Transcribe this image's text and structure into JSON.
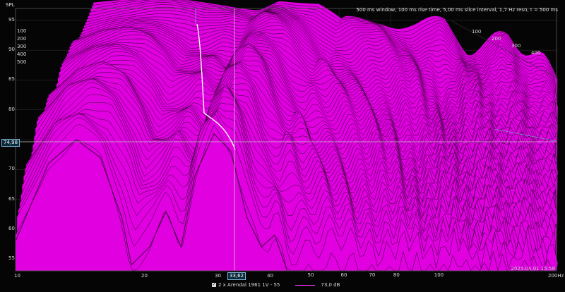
{
  "header": {
    "spl_label": "SPL",
    "info": "500 ms window, 100 ms rise time, 5,00 ms slice interval, 1,7 Hz resn, t = 500 ms"
  },
  "y_axis": {
    "ticks": [
      "95",
      "90",
      "85",
      "80",
      "75",
      "70",
      "65",
      "60",
      "55"
    ]
  },
  "x_axis": {
    "ticks": [
      "10",
      "20",
      "30",
      "40",
      "50",
      "60",
      "70",
      "80",
      "100",
      "200Hz"
    ]
  },
  "time_axis": {
    "left": [
      "100",
      "200",
      "300",
      "400",
      "500"
    ],
    "right": [
      "100",
      "200",
      "300",
      "400"
    ]
  },
  "cursor": {
    "spl_value": "74,98",
    "freq_value": "33,62"
  },
  "legend": {
    "checkbox_mark": "✓",
    "series_name": "2 x Arendal 1961 1V - 55",
    "value": "73,0 dB"
  },
  "timestamp": "2025.04.01 15:58",
  "colors": {
    "fill": "#e000e0",
    "slice_line": "#2a002a",
    "grid": "#2c2c2c",
    "cursor_line": "#c8c8c8",
    "trace": "#ffffff"
  },
  "chart_data": {
    "type": "waterfall",
    "xlim_hz": [
      10,
      200
    ],
    "ylim_db": [
      53,
      97
    ],
    "scale_x": "log",
    "slices": 101,
    "slice_interval_ms": 5,
    "window_ms": 500,
    "grid": true,
    "front_response": [
      [
        10,
        58
      ],
      [
        12,
        71
      ],
      [
        14,
        75
      ],
      [
        16,
        72
      ],
      [
        18,
        62
      ],
      [
        19,
        54
      ],
      [
        21,
        57
      ],
      [
        23,
        63
      ],
      [
        25,
        57
      ],
      [
        27,
        69
      ],
      [
        30,
        76
      ],
      [
        33,
        73
      ],
      [
        36,
        62
      ],
      [
        39,
        57
      ],
      [
        42,
        59
      ],
      [
        45,
        53
      ]
    ],
    "rear_response": [
      [
        10,
        95
      ],
      [
        15,
        96
      ],
      [
        20,
        95.5
      ],
      [
        25,
        95
      ],
      [
        28,
        96.5
      ],
      [
        35,
        95
      ],
      [
        40,
        92
      ],
      [
        50,
        93
      ],
      [
        60,
        92
      ],
      [
        70,
        92
      ],
      [
        80,
        88
      ],
      [
        100,
        90
      ],
      [
        120,
        86
      ],
      [
        150,
        80
      ],
      [
        200,
        75
      ]
    ]
  }
}
